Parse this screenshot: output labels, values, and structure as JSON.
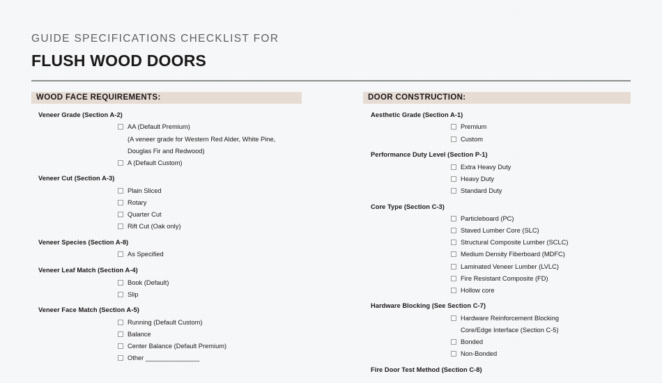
{
  "document": {
    "eyebrow": "GUIDE SPECIFICATIONS CHECKLIST FOR",
    "title": "FLUSH WOOD DOORS",
    "accent_bar_color": "#e7dcd4",
    "rule_color": "#8a918c",
    "background_color": "#f8f9fa"
  },
  "left_column": {
    "header": "WOOD FACE REQUIREMENTS:",
    "sections": [
      {
        "title": "Veneer Grade (Section A-2)",
        "options": [
          {
            "label": "AA (Default Premium)",
            "checked": false,
            "checkbox": true
          },
          {
            "label": "(A veneer grade for Western Red Alder, White Pine,",
            "checked": false,
            "checkbox": false
          },
          {
            "label": "Douglas Fir and Redwood)",
            "checked": false,
            "checkbox": false
          },
          {
            "label": "A (Default Custom)",
            "checked": false,
            "checkbox": true
          }
        ]
      },
      {
        "title": "Veneer Cut (Section A-3)",
        "options": [
          {
            "label": "Plain Sliced",
            "checked": false,
            "checkbox": true
          },
          {
            "label": "Rotary",
            "checked": false,
            "checkbox": true
          },
          {
            "label": "Quarter Cut",
            "checked": false,
            "checkbox": true
          },
          {
            "label": "Rift Cut (Oak only)",
            "checked": false,
            "checkbox": true
          }
        ]
      },
      {
        "title": "Veneer Species (Section A-8)",
        "options": [
          {
            "label": "As Specified",
            "checked": false,
            "checkbox": true
          }
        ]
      },
      {
        "title": "Veneer Leaf Match (Section A-4)",
        "options": [
          {
            "label": "Book (Default)",
            "checked": false,
            "checkbox": true
          },
          {
            "label": "Slip",
            "checked": false,
            "checkbox": true
          }
        ]
      },
      {
        "title": "Veneer Face Match (Section A-5)",
        "options": [
          {
            "label": "Running (Default Custom)",
            "checked": false,
            "checkbox": true
          },
          {
            "label": "Balance",
            "checked": false,
            "checkbox": true
          },
          {
            "label": "Center Balance (Default Premium)",
            "checked": false,
            "checkbox": true
          },
          {
            "label": "Other _______________",
            "checked": false,
            "checkbox": true
          }
        ]
      }
    ]
  },
  "right_column": {
    "header": "DOOR CONSTRUCTION:",
    "sections": [
      {
        "title": "Aesthetic Grade (Section A-1)",
        "options": [
          {
            "label": "Premium",
            "checked": false,
            "checkbox": true
          },
          {
            "label": "Custom",
            "checked": false,
            "checkbox": true
          }
        ]
      },
      {
        "title": "Performance Duty Level (Section P-1)",
        "options": [
          {
            "label": "Extra Heavy Duty",
            "checked": false,
            "checkbox": true
          },
          {
            "label": "Heavy Duty",
            "checked": false,
            "checkbox": true
          },
          {
            "label": "Standard Duty",
            "checked": false,
            "checkbox": true
          }
        ]
      },
      {
        "title": "Core Type (Section C-3)",
        "options": [
          {
            "label": "Particleboard (PC)",
            "checked": false,
            "checkbox": true
          },
          {
            "label": "Staved Lumber Core (SLC)",
            "checked": false,
            "checkbox": true
          },
          {
            "label": "Structural Composite Lumber (SCLC)",
            "checked": false,
            "checkbox": true
          },
          {
            "label": "Medium Density Fiberboard (MDFC)",
            "checked": false,
            "checkbox": true
          },
          {
            "label": "Laminated Veneer Lumber (LVLC)",
            "checked": false,
            "checkbox": true
          },
          {
            "label": "Fire Resistant Composite (FD)",
            "checked": false,
            "checkbox": true
          },
          {
            "label": "Hollow core",
            "checked": false,
            "checkbox": true
          }
        ]
      },
      {
        "title": "Hardware Blocking (See Section C-7)",
        "options": [
          {
            "label": "Hardware Reinforcement Blocking",
            "checked": false,
            "checkbox": true
          },
          {
            "label": "Core/Edge Interface (Section C-5)",
            "checked": false,
            "checkbox": false
          },
          {
            "label": "Bonded",
            "checked": false,
            "checkbox": true
          },
          {
            "label": "Non-Bonded",
            "checked": false,
            "checkbox": true
          }
        ]
      },
      {
        "title": "Fire Door Test Method (Section C-8)",
        "options": []
      }
    ]
  }
}
